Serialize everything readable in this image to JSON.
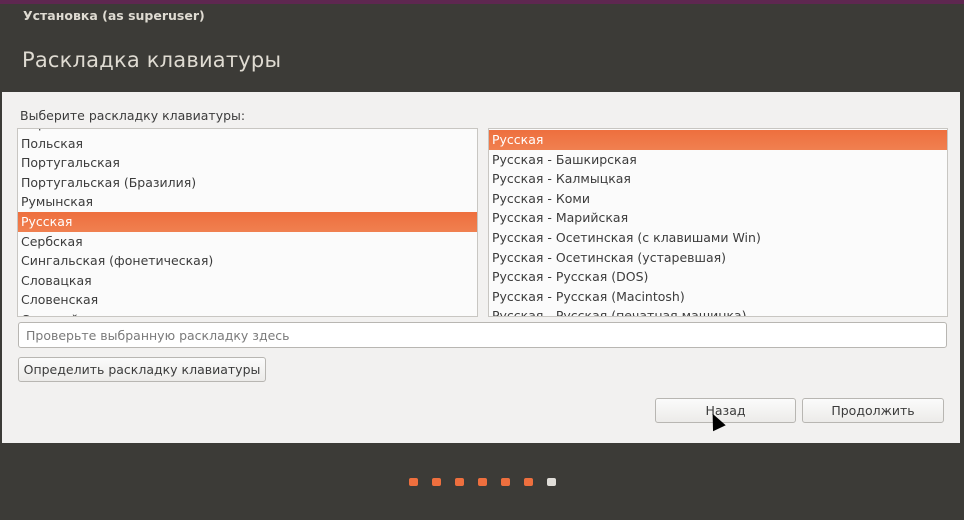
{
  "window_title": "Установка (as superuser)",
  "page_title": "Раскладка клавиатуры",
  "choose_label": "Выберите раскладку клавиатуры:",
  "layouts": [
    "Норвежская",
    "Польская",
    "Португальская",
    "Португальская (Бразилия)",
    "Румынская",
    "Русская",
    "Сербская",
    "Сингальская (фонетическая)",
    "Словацкая",
    "Словенская",
    "Сомалийская"
  ],
  "layouts_selected": "Русская",
  "variants": [
    "Русская",
    "Русская - Башкирская",
    "Русская - Калмыцкая",
    "Русская - Коми",
    "Русская - Марийская",
    "Русская - Осетинская (с клавишами Win)",
    "Русская - Осетинская (устаревшая)",
    "Русская - Русская (DOS)",
    "Русская - Русская (Macintosh)",
    "Русская - Русская (печатная машинка)"
  ],
  "variants_selected": "Русская",
  "test_placeholder": "Проверьте выбранную раскладку здесь",
  "detect_button": "Определить раскладку клавиатуры",
  "back_button": "Назад",
  "continue_button": "Продолжить",
  "progress": {
    "total_steps": 7,
    "current_step": 7
  },
  "colors": {
    "accent": "#ee6f3e",
    "dark": "#3c3b37",
    "body": "#f2f1f0"
  }
}
